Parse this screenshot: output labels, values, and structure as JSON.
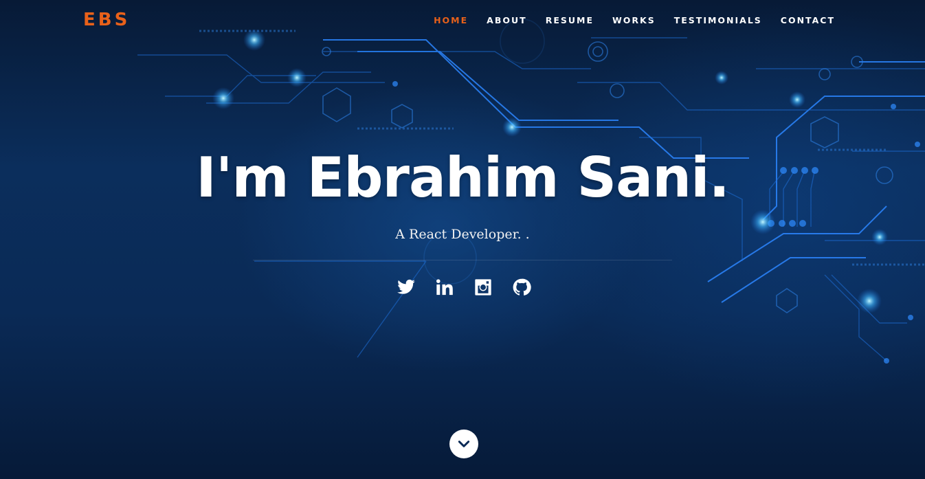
{
  "nav": {
    "logo": "EBS",
    "items": [
      {
        "label": "HOME",
        "active": true
      },
      {
        "label": "ABOUT",
        "active": false
      },
      {
        "label": "RESUME",
        "active": false
      },
      {
        "label": "WORKS",
        "active": false
      },
      {
        "label": "TESTIMONIALS",
        "active": false
      },
      {
        "label": "CONTACT",
        "active": false
      }
    ]
  },
  "banner": {
    "headline": "I'm Ebrahim Sani.",
    "subtitle": "A React Developer. ."
  },
  "social": [
    {
      "icon": "twitter-icon"
    },
    {
      "icon": "linkedin-icon"
    },
    {
      "icon": "instagram-icon"
    },
    {
      "icon": "github-icon"
    }
  ],
  "scroll": {
    "icon": "chevron-down-icon"
  },
  "colors": {
    "accent": "#e8611a",
    "background": "#0a2a56",
    "text": "#ffffff",
    "circuit": "#2f8cff"
  }
}
